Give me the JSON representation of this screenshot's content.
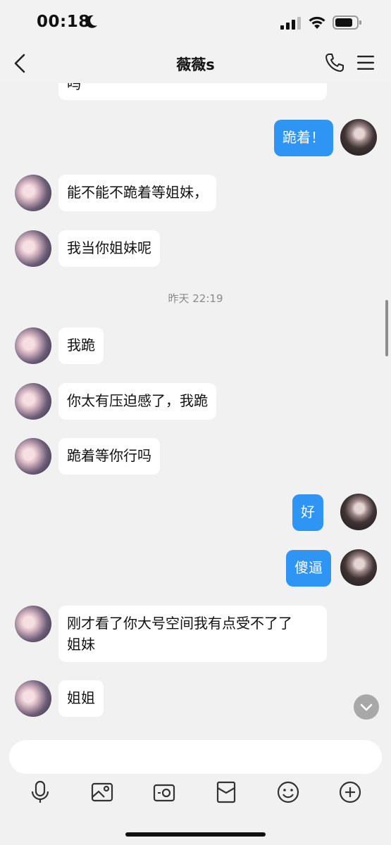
{
  "status_bar": {
    "time": "00:18"
  },
  "header": {
    "title": "薇薇s"
  },
  "messages": [
    {
      "side": "them",
      "text": "吗"
    },
    {
      "side": "me",
      "text": "跪着！"
    },
    {
      "side": "them",
      "text": "能不能不跪着等姐妹，"
    },
    {
      "side": "them",
      "text": "我当你姐妹呢"
    },
    {
      "side": "time",
      "text": "昨天 22:19"
    },
    {
      "side": "them",
      "text": "我跪"
    },
    {
      "side": "them",
      "text": "你太有压迫感了，我跪"
    },
    {
      "side": "them",
      "text": "跪着等你行吗"
    },
    {
      "side": "me",
      "text": "好"
    },
    {
      "side": "me",
      "text": "傻逼"
    },
    {
      "side": "them",
      "text": "刚才看了你大号空间我有点受不了了"
    },
    {
      "side": "them",
      "text": "姐妹"
    },
    {
      "side": "them",
      "text": "姐姐"
    }
  ],
  "input": {
    "placeholder": ""
  },
  "colors": {
    "accent": "#2f95f4",
    "background": "#f1f1f2"
  },
  "toolbar_icons": [
    "microphone-icon",
    "image-icon",
    "camera-icon",
    "red-packet-icon",
    "emoji-icon",
    "plus-icon"
  ]
}
